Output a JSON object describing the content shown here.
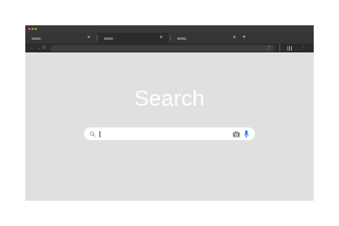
{
  "window": {
    "controls": [
      "close",
      "minimize",
      "maximize"
    ]
  },
  "tabs": [
    {
      "label": "www.",
      "close": "×",
      "active": false
    },
    {
      "label": "www.",
      "close": "×",
      "active": true
    },
    {
      "label": "www.",
      "close": "×",
      "active": false
    }
  ],
  "new_tab": "+",
  "toolbar": {
    "back": "←",
    "forward": "→",
    "reload": "↻",
    "address_value": "",
    "star": "☆",
    "more": "⋮"
  },
  "main": {
    "title": "Search",
    "search_value": "",
    "search_placeholder": ""
  },
  "colors": {
    "page_bg": "#e0e0e0",
    "chrome_dark": "#2c2c2c",
    "tab_bar": "#353535",
    "mic_accent": "#1a73e8"
  }
}
